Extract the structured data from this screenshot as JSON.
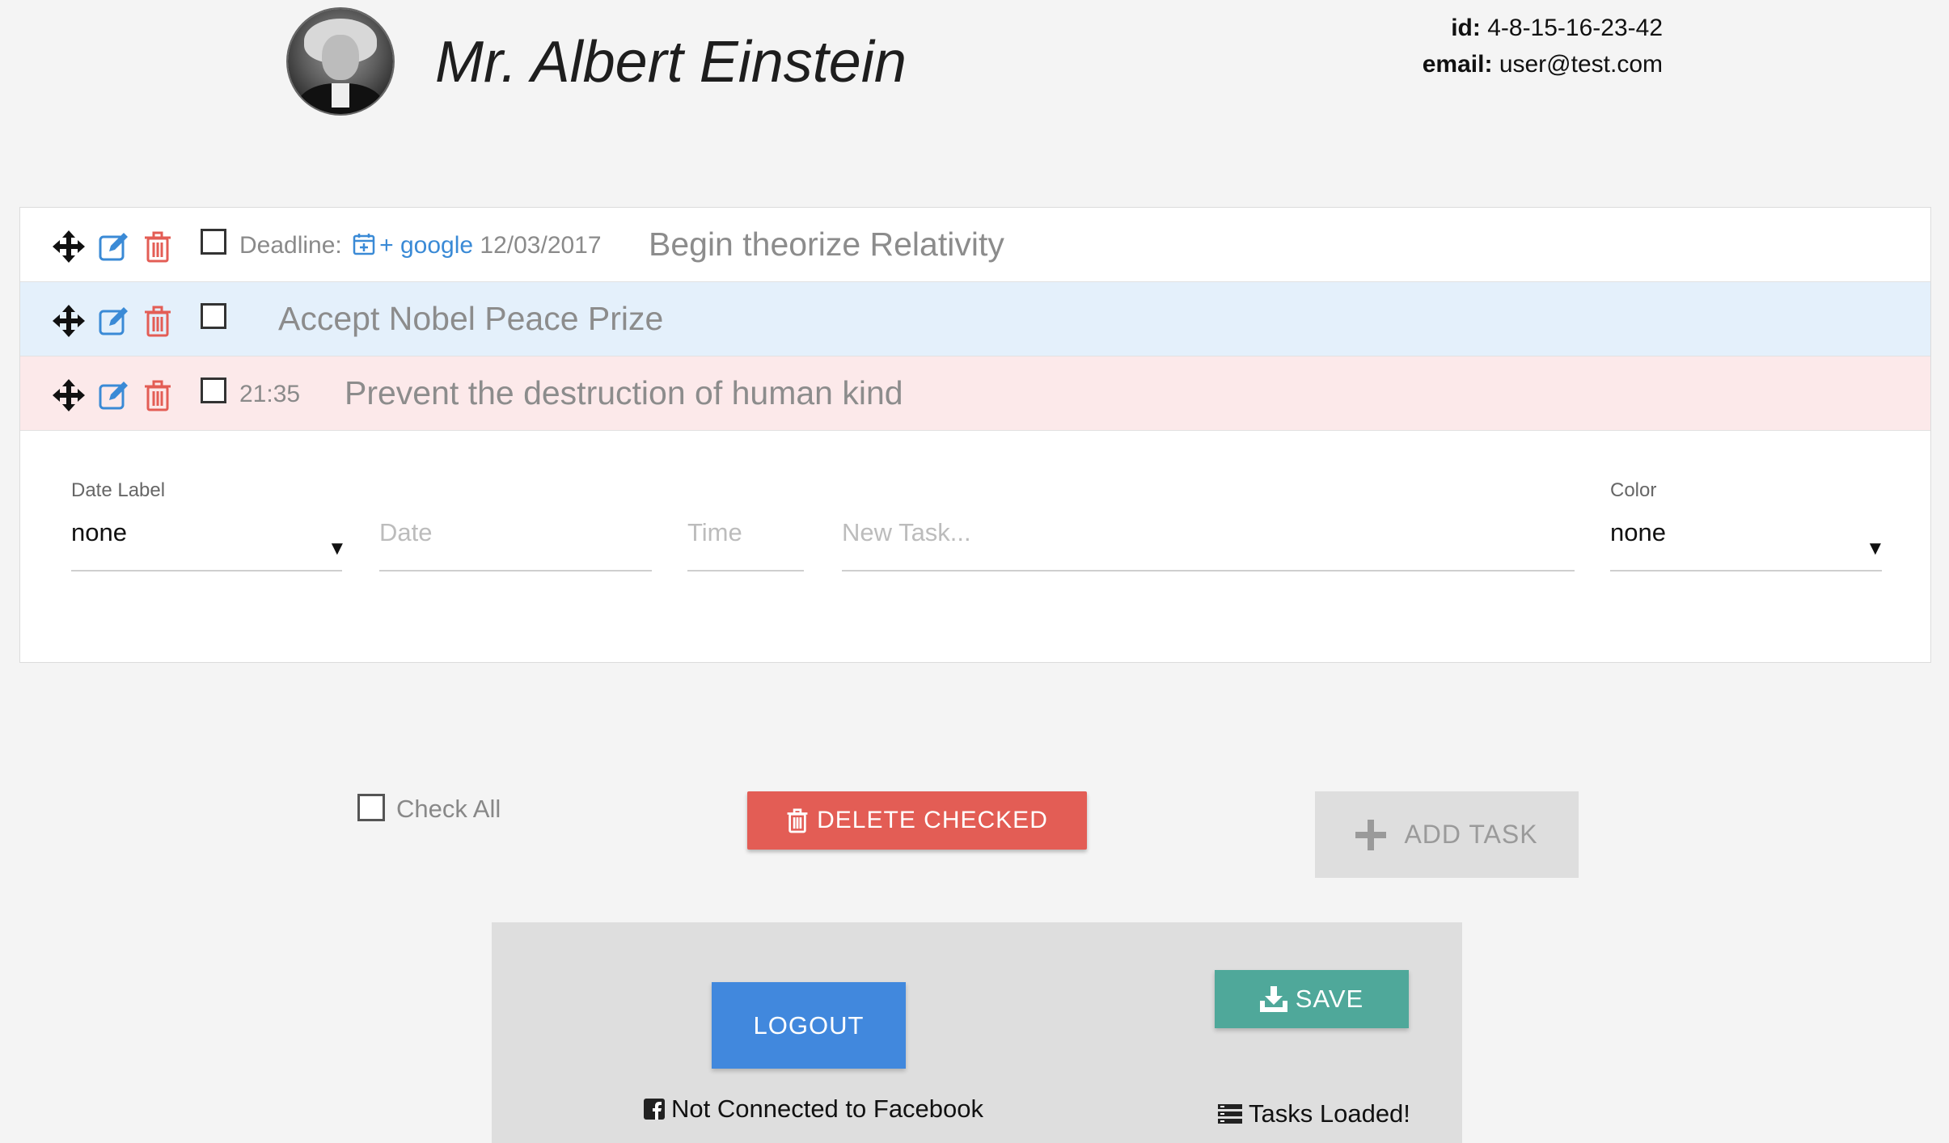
{
  "header": {
    "name": "Mr. Albert Einstein",
    "id_label": "id:",
    "id_value": "4-8-15-16-23-42",
    "email_label": "email:",
    "email_value": "user@test.com"
  },
  "tasks": [
    {
      "deadline_label": "Deadline:",
      "calendar_link": "+ google",
      "date": "12/03/2017",
      "text": "Begin theorize Relativity",
      "color": "#ffffff"
    },
    {
      "text": "Accept Nobel Peace Prize",
      "color": "#e4f0fb"
    },
    {
      "time": "21:35",
      "text": "Prevent the destruction of human kind",
      "color": "#fce9ea"
    }
  ],
  "form": {
    "date_label_label": "Date Label",
    "date_label_value": "none",
    "date_placeholder": "Date",
    "time_placeholder": "Time",
    "task_placeholder": "New Task...",
    "color_label": "Color",
    "color_value": "none"
  },
  "controls": {
    "check_all": "Check All",
    "delete_checked": "DELETE CHECKED",
    "add_task": "ADD TASK"
  },
  "footer": {
    "logout": "LOGOUT",
    "save": "SAVE",
    "facebook_status": "Not Connected to Facebook",
    "tasks_status": "Tasks Loaded!"
  },
  "colors": {
    "delete": "#e35d55",
    "logout": "#4188dd",
    "save": "#4fa89a",
    "edit_icon": "#3a8ad6",
    "trash_icon": "#e35d55"
  },
  "icons": [
    "move-icon",
    "edit-icon",
    "trash-icon",
    "calendar-plus-icon",
    "plus-icon",
    "download-icon",
    "facebook-icon",
    "tasks-list-icon"
  ]
}
